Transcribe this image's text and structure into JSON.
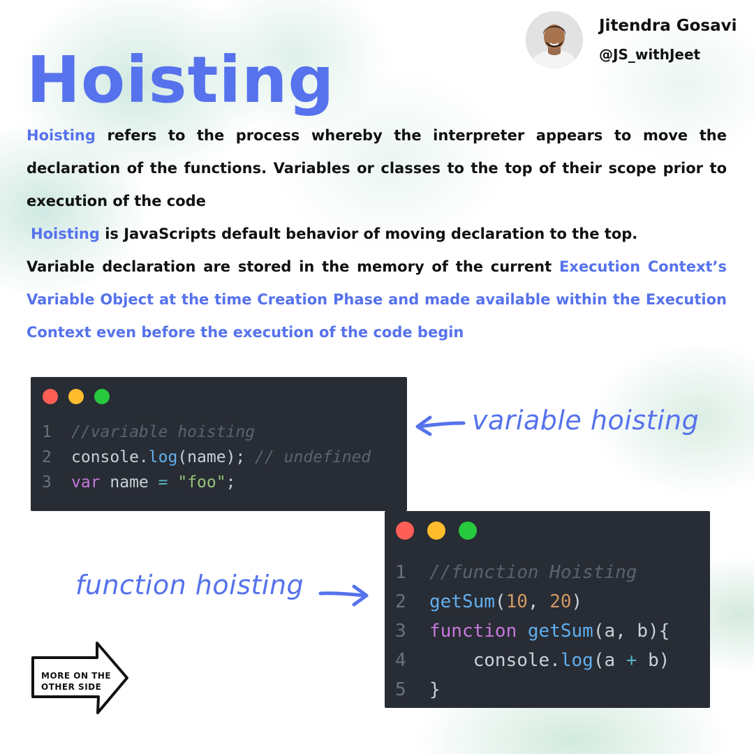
{
  "author": {
    "name": "Jitendra Gosavi",
    "handle": "@JS_withJeet"
  },
  "title": "Hoisting",
  "paragraph1": {
    "highlight": "Hoisting",
    "text": " refers to the process whereby the interpreter appears to move the declaration of the functions. Variables or classes to the top of their scope prior to execution of the code"
  },
  "paragraph2": {
    "highlight": "Hoisting",
    "text": " is JavaScripts default behavior of moving declaration to the top."
  },
  "paragraph3": {
    "text": "Variable declaration are stored in the memory of the current ",
    "highlight": "Execution Context’s Variable Object at the time Creation Phase and made available within the Execution Context even before the execution of the code begin"
  },
  "window_buttons": {
    "colors": [
      "#ff5f56",
      "#ffbd2e",
      "#27c93f"
    ]
  },
  "code1": {
    "lines": [
      {
        "num": "1",
        "tokens": [
          {
            "t": "//variable hoisting",
            "c": "comment"
          }
        ]
      },
      {
        "num": "2",
        "tokens": [
          {
            "t": "console.",
            "c": "plain"
          },
          {
            "t": "log",
            "c": "fn"
          },
          {
            "t": "(name); ",
            "c": "plain"
          },
          {
            "t": "// undefined",
            "c": "comment"
          }
        ]
      },
      {
        "num": "3",
        "tokens": [
          {
            "t": "var",
            "c": "kw"
          },
          {
            "t": " name ",
            "c": "plain"
          },
          {
            "t": "=",
            "c": "op"
          },
          {
            "t": " ",
            "c": "plain"
          },
          {
            "t": "\"foo\"",
            "c": "str"
          },
          {
            "t": ";",
            "c": "plain"
          }
        ]
      }
    ]
  },
  "code2": {
    "lines": [
      {
        "num": "1",
        "tokens": [
          {
            "t": "//function Hoisting",
            "c": "comment"
          }
        ]
      },
      {
        "num": "2",
        "tokens": [
          {
            "t": "getSum",
            "c": "fn"
          },
          {
            "t": "(",
            "c": "plain"
          },
          {
            "t": "10",
            "c": "num"
          },
          {
            "t": ", ",
            "c": "plain"
          },
          {
            "t": "20",
            "c": "num"
          },
          {
            "t": ")",
            "c": "plain"
          }
        ]
      },
      {
        "num": "3",
        "tokens": [
          {
            "t": "function",
            "c": "kw"
          },
          {
            "t": " ",
            "c": "plain"
          },
          {
            "t": "getSum",
            "c": "fn"
          },
          {
            "t": "(a, b){",
            "c": "plain"
          }
        ]
      },
      {
        "num": "4",
        "tokens": [
          {
            "t": "    console.",
            "c": "plain"
          },
          {
            "t": "log",
            "c": "fn"
          },
          {
            "t": "(a ",
            "c": "plain"
          },
          {
            "t": "+",
            "c": "op"
          },
          {
            "t": " b)",
            "c": "plain"
          }
        ]
      },
      {
        "num": "5",
        "tokens": [
          {
            "t": "}",
            "c": "plain"
          }
        ]
      }
    ]
  },
  "annotations": {
    "variable": "variable hoisting",
    "function": "function hoisting"
  },
  "more_badge": {
    "line1": "MORE ON THE",
    "line2": "OTHER SIDE"
  },
  "accent_color": "#5672ec",
  "icons": [
    "avatar-photo",
    "arrow-left-icon",
    "arrow-right-icon",
    "next-arrow-icon"
  ]
}
